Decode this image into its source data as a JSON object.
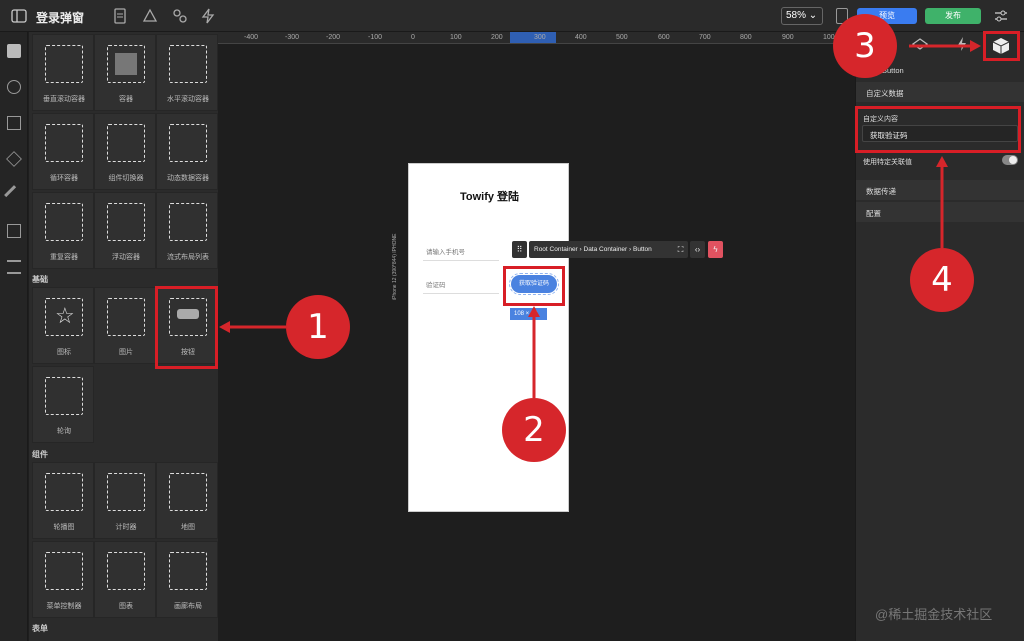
{
  "app": {
    "title": "登录弹窗",
    "zoom": "58%",
    "preview_label": "预览",
    "publish_label": "发布"
  },
  "ruler": {
    "ticks": [
      "-400",
      "-300",
      "-200",
      "-100",
      "0",
      "100",
      "200",
      "300",
      "400",
      "500",
      "600",
      "700",
      "800",
      "900",
      "100"
    ]
  },
  "panel": {
    "sections": {
      "basic": "基础",
      "components": "组件",
      "form": "表单"
    },
    "items": [
      "垂直滚动容器",
      "容器",
      "水平滚动容器",
      "循环容器",
      "组件切换器",
      "动态数据容器",
      "重复容器",
      "浮动容器",
      "流式布局列表",
      "图标",
      "图片",
      "按钮",
      "轮询",
      "轮播图",
      "计时器",
      "地图",
      "菜单控制器",
      "图表",
      "画廊布局"
    ]
  },
  "phone": {
    "title": "Towify 登陆",
    "phone_placeholder": "请输入手机号",
    "code_placeholder": "验证码",
    "code_button": "获取验证码",
    "size_badge": "108 × 30",
    "device_label": "iPhone 12 (390*844)  IPHONE"
  },
  "breadcrumb": {
    "path": "Root Container  ›  Data Container  ›  Button"
  },
  "rpanel": {
    "component_name": "Button",
    "section_custom_data": "自定义数据",
    "custom_content_label": "自定义内容",
    "custom_content_value": "获取验证码",
    "specific_value_label": "使用特定关联值",
    "section_data_pass": "数据传递",
    "section_config": "配置"
  },
  "annotations": {
    "one": "1",
    "two": "2",
    "three": "3",
    "four": "4"
  },
  "watermark": "@稀土掘金技术社区",
  "colors": {
    "accent": "#d6262b",
    "primary": "#3a7cf0",
    "success": "#3fb26a"
  }
}
